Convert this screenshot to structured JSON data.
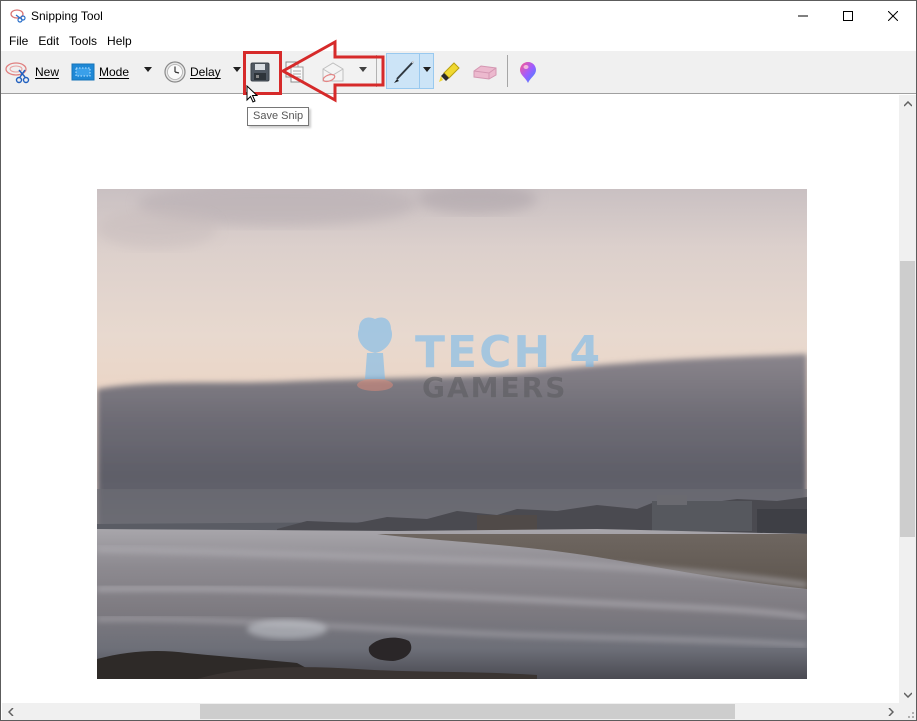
{
  "window": {
    "title": "Snipping Tool",
    "controls": {
      "minimize": "minimize",
      "maximize": "maximize",
      "close": "close"
    }
  },
  "menu": {
    "items": [
      {
        "label": "File"
      },
      {
        "label": "Edit"
      },
      {
        "label": "Tools"
      },
      {
        "label": "Help"
      }
    ]
  },
  "toolbar": {
    "new": {
      "label": "New",
      "icon": "scissors-icon"
    },
    "mode": {
      "label": "Mode",
      "icon": "rectangle-snip-icon"
    },
    "delay": {
      "label": "Delay",
      "icon": "clock-icon"
    },
    "save": {
      "icon": "floppy-disk-icon",
      "tooltip": "Save Snip"
    },
    "copy": {
      "icon": "copy-icon"
    },
    "send": {
      "icon": "email-envelope-icon"
    },
    "pen": {
      "icon": "pen-icon",
      "active": true
    },
    "highlighter": {
      "icon": "highlighter-icon"
    },
    "eraser": {
      "icon": "eraser-icon"
    },
    "paint3d": {
      "icon": "paint-3d-icon"
    }
  },
  "annotations": {
    "highlight_color": "#d62a2a",
    "arrow_direction": "left",
    "arrow_points_to": "Save Snip"
  },
  "content": {
    "image_description": "Captured snip: beach at dusk with overcast sky, waves and distant buildings",
    "watermark": {
      "line1": "TECH 4",
      "line2": "GAMERS"
    }
  },
  "scrollbars": {
    "vertical": {
      "position_fraction": 0.26,
      "visible_fraction": 0.48
    },
    "horizontal": {
      "position_fraction": 0.21,
      "visible_fraction": 0.62
    }
  },
  "colors": {
    "toolbar_bg": "#f0f0f0",
    "active_tool_bg": "#cce4f7",
    "scroll_thumb": "#cdcdcd"
  }
}
